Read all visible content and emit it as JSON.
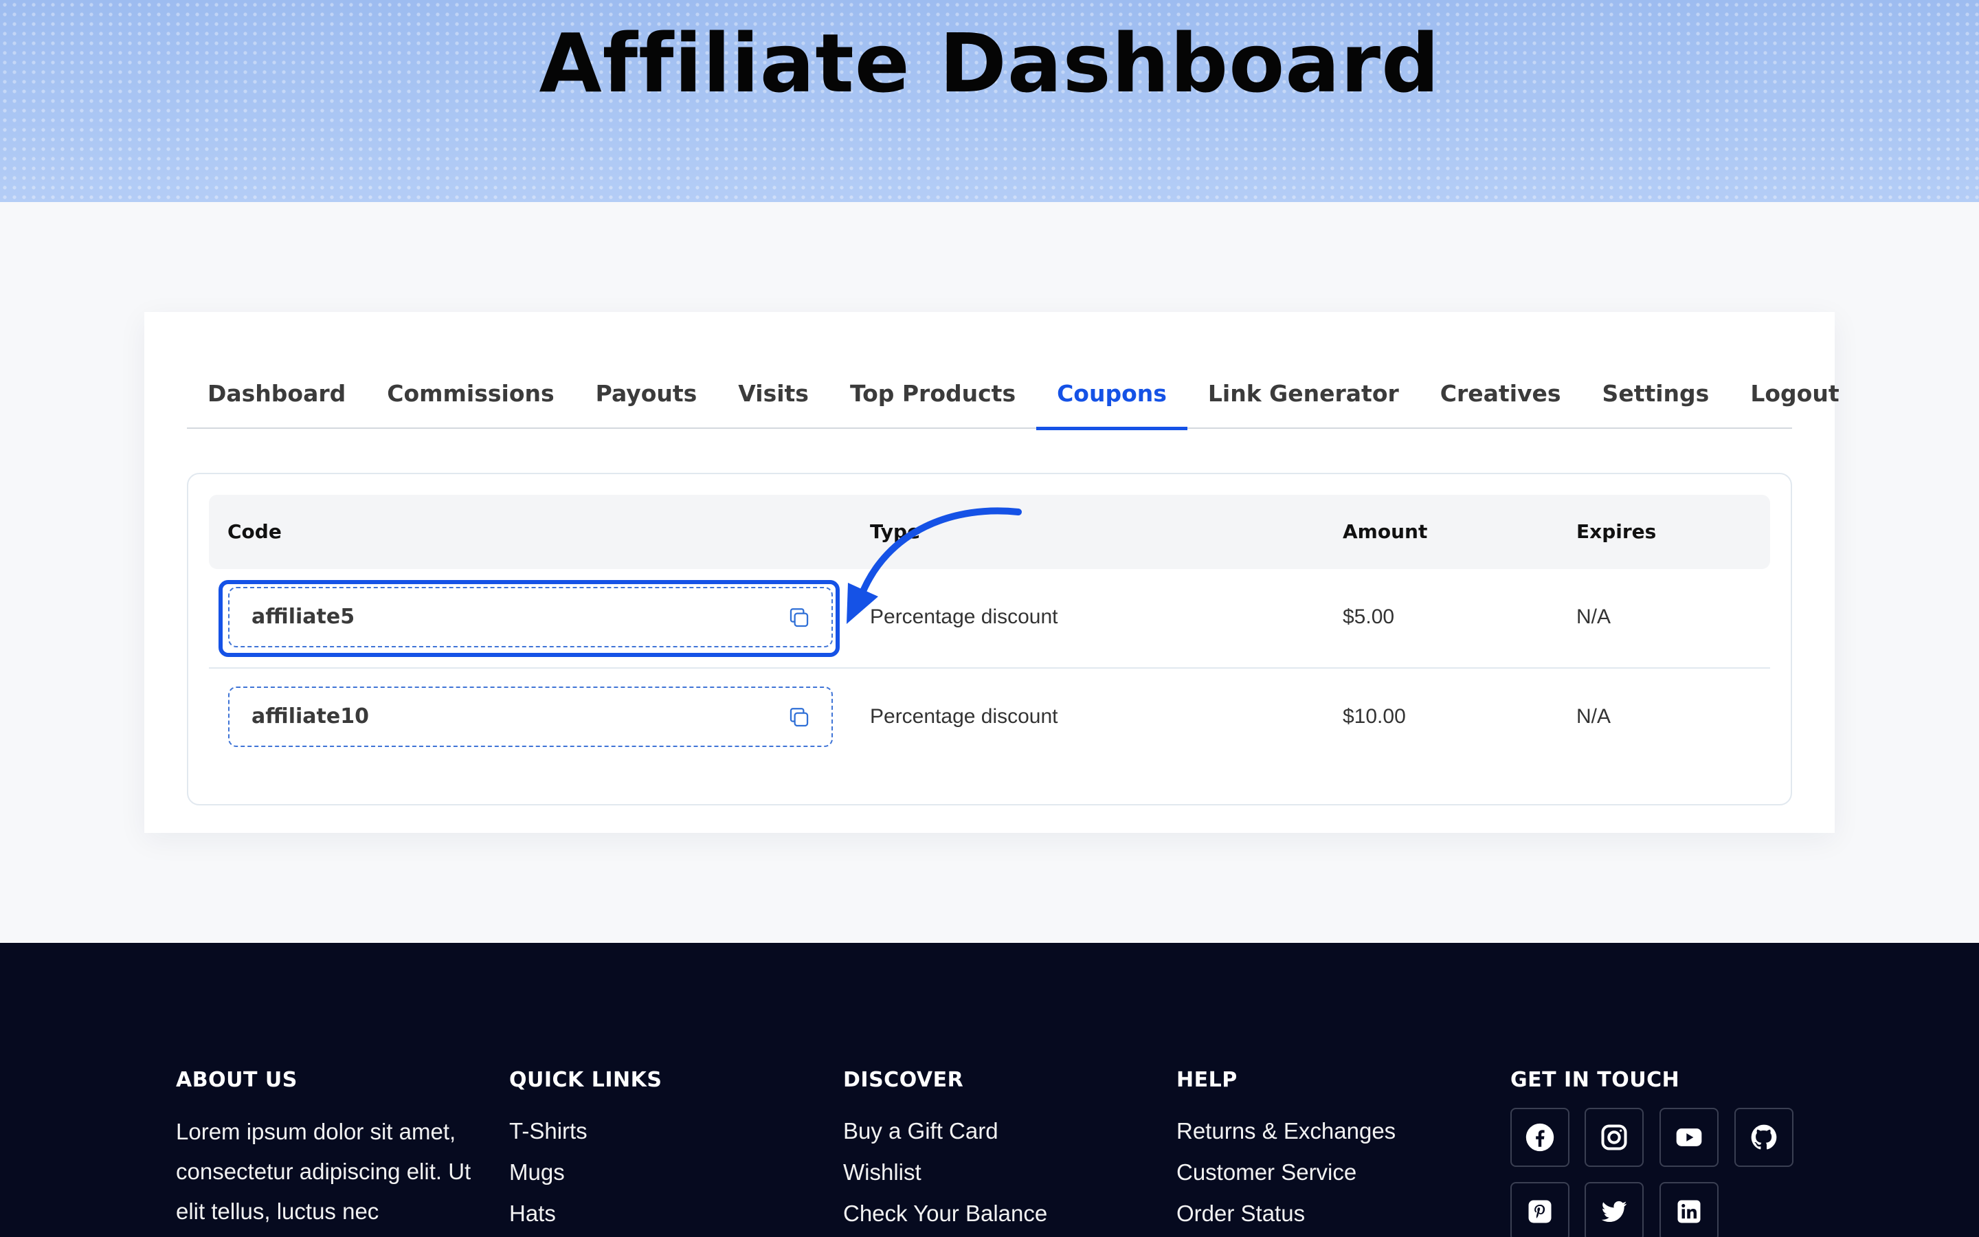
{
  "hero": {
    "title": "Affiliate Dashboard"
  },
  "tabs": [
    {
      "label": "Dashboard"
    },
    {
      "label": "Commissions"
    },
    {
      "label": "Payouts"
    },
    {
      "label": "Visits"
    },
    {
      "label": "Top Products"
    },
    {
      "label": "Coupons",
      "active": true
    },
    {
      "label": "Link Generator"
    },
    {
      "label": "Creatives"
    },
    {
      "label": "Settings"
    },
    {
      "label": "Logout"
    }
  ],
  "coupons_table": {
    "headers": {
      "code": "Code",
      "type": "Type",
      "amount": "Amount",
      "expires": "Expires"
    },
    "rows": [
      {
        "code": "affiliate5",
        "type": "Percentage discount",
        "amount": "$5.00",
        "expires": "N/A"
      },
      {
        "code": "affiliate10",
        "type": "Percentage discount",
        "amount": "$10.00",
        "expires": "N/A"
      }
    ]
  },
  "footer": {
    "about": {
      "heading": "ABOUT US",
      "text": "Lorem ipsum dolor sit amet, consectetur adipiscing elit. Ut elit tellus, luctus nec"
    },
    "quick_links": {
      "heading": "QUICK LINKS",
      "items": [
        "T-Shirts",
        "Mugs",
        "Hats"
      ]
    },
    "discover": {
      "heading": "DISCOVER",
      "items": [
        "Buy a Gift Card",
        "Wishlist",
        "Check Your Balance"
      ]
    },
    "help": {
      "heading": "HELP",
      "items": [
        "Returns & Exchanges",
        "Customer Service",
        "Order Status"
      ]
    },
    "contact": {
      "heading": "GET IN TOUCH",
      "socials": [
        "facebook-icon",
        "instagram-icon",
        "youtube-icon",
        "github-icon",
        "pinterest-icon",
        "twitter-icon",
        "linkedin-icon"
      ]
    }
  },
  "colors": {
    "accent": "#1552e6",
    "footer_bg": "#060a1f",
    "hero_bg": "#aac6f4"
  }
}
